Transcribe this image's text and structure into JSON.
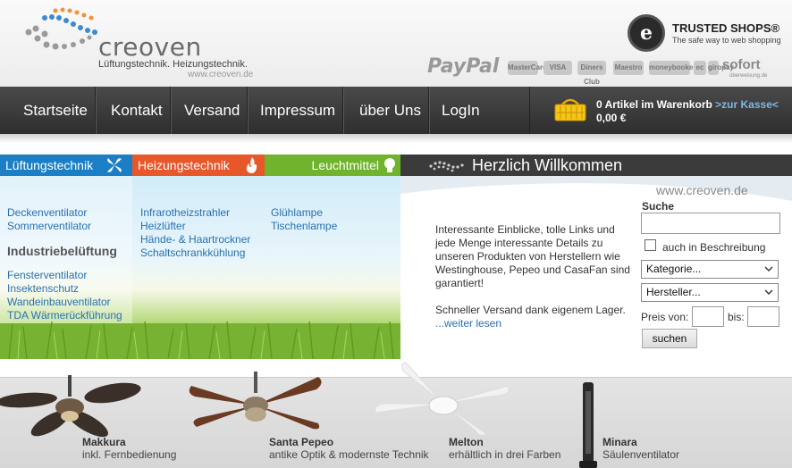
{
  "header": {
    "logo_name": "creoven",
    "logo_tagline": "Lüftungstechnik. Heizungstechnik.",
    "logo_url": "www.creoven.de",
    "trusted_shops_title": "TRUSTED SHOPS®",
    "trusted_shops_subtitle": "The safe way to web shopping",
    "trusted_shops_seal_icon": "trusted-shops-seal-icon",
    "payment_paypal": "PayPal",
    "payment_sofort": "sofort",
    "payment_sofort_sub": "überweisung.de",
    "payment_chips": [
      "MasterCard",
      "VISA",
      "Diners Club",
      "Maestro",
      "moneybookers",
      "ec",
      "giropay"
    ]
  },
  "nav": {
    "items": [
      "Startseite",
      "Kontakt",
      "Versand",
      "Impressum",
      "über Uns",
      "LogIn"
    ],
    "cart_text": "0 Artikel im Warenkorb",
    "cart_link": ">zur Kasse<",
    "cart_total": "0,00 €",
    "cart_icon": "shopping-basket-icon"
  },
  "categories": {
    "tabs": [
      "Lüftungstechnik",
      "Heizungstechnik",
      "Leuchtmittel"
    ],
    "col1_links_top": [
      "Deckenventilator",
      "Sommerventilator"
    ],
    "col1_heading": "Industriebelüftung",
    "col1_links_bottom": [
      "Fensterventilator",
      "Insektenschutz",
      "Wandeinbauventilator",
      "TDA Wärmerückführung"
    ],
    "col2_links": [
      "Infrarotheizstrahler",
      "Heizlüfter",
      "Hände- & Haartrockner",
      "Schaltschrankkühlung"
    ],
    "col3_links": [
      "Glühlampe",
      "Tischenlampe"
    ]
  },
  "welcome": {
    "title": "Herzlich Willkommen",
    "url": "www.creoven.de",
    "paragraph1": "Interessante Einblicke, tolle Links und jede Menge interessante Details zu unseren Produkten von Herstellern wie Westinghouse, Pepeo und CasaFan sind garantiert!",
    "paragraph2": "Schneller Versand dank eigenem Lager.",
    "more_link": "...weiter lesen"
  },
  "search": {
    "label": "Suche",
    "input_value": "",
    "in_description_label": "auch in Beschreibung",
    "category_select": "Kategorie...",
    "manufacturer_select": "Hersteller...",
    "price_from_label": "Preis von:",
    "price_to_label": "bis:",
    "button_label": "suchen"
  },
  "products": [
    {
      "name": "Makkura",
      "desc": "inkl. Fernbedienung"
    },
    {
      "name": "Santa Pepeo",
      "desc": "antike Optik & modernste Technik"
    },
    {
      "name": "Melton",
      "desc": "erhältlich in drei Farben"
    },
    {
      "name": "Minara",
      "desc": "Säulenventilator"
    }
  ],
  "colors": {
    "lueftung": "#1b7fc6",
    "heizung": "#e7572a",
    "leuchtmittel": "#6fb42c",
    "nav_bg": "#3a3a3a",
    "link": "#2a70b0"
  }
}
